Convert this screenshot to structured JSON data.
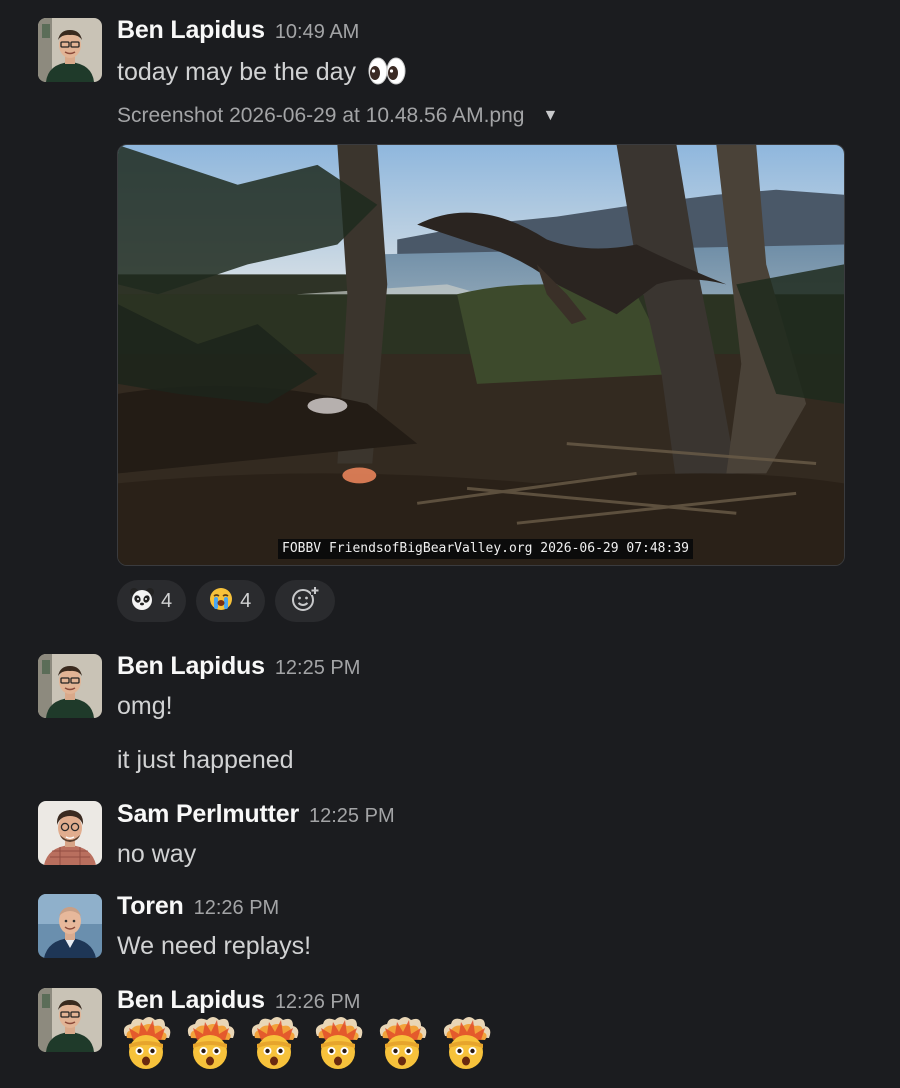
{
  "messages": [
    {
      "author": "Ben Lapidus",
      "time": "10:49 AM",
      "text": "today may be the day",
      "text_emoji": "👀",
      "attachment": {
        "file_name": "Screenshot 2026-06-29 at 10.48.56 AM.png",
        "overlay_caption": "FOBBV FriendsofBigBearValley.org 2026-06-29 07:48:39"
      },
      "reactions": [
        {
          "emoji": "panda-face-icon",
          "count": "4"
        },
        {
          "emoji": "loudly-crying-face-icon",
          "count": "4"
        }
      ]
    },
    {
      "author": "Ben Lapidus",
      "time": "12:25 PM",
      "lines": [
        "omg!",
        "it just happened"
      ]
    },
    {
      "author": "Sam Perlmutter",
      "time": "12:25 PM",
      "text": "no way"
    },
    {
      "author": "Toren",
      "time": "12:26 PM",
      "text": "We need replays!"
    },
    {
      "author": "Ben Lapidus",
      "time": "12:26 PM",
      "emoji_row": [
        "exploding-head-icon",
        "exploding-head-icon",
        "exploding-head-icon",
        "exploding-head-icon",
        "exploding-head-icon",
        "exploding-head-icon"
      ]
    }
  ],
  "colors": {
    "background": "#1b1c1f",
    "name": "#f8f8f8",
    "timestamp": "#a3a4a6",
    "reaction_pill": "#2a2b2e"
  }
}
